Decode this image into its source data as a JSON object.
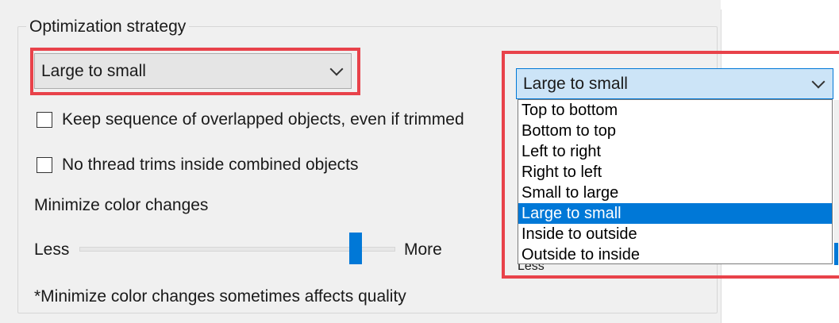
{
  "group": {
    "title": "Optimization strategy"
  },
  "strategy_combo_closed": {
    "value": "Large to small",
    "icon": "chevron-down-icon"
  },
  "strategy_combo_open": {
    "value": "Large to small",
    "icon": "chevron-down-icon",
    "options": [
      "Top to bottom",
      "Bottom to top",
      "Left to right",
      "Right to left",
      "Small to large",
      "Large to small",
      "Inside to outside",
      "Outside to inside"
    ],
    "selected_index": 5
  },
  "checkboxes": [
    {
      "label": "Keep sequence of overlapped objects, even if trimmed",
      "checked": false
    },
    {
      "label": "No thread trims inside combined objects",
      "checked": false
    }
  ],
  "color_changes": {
    "label": "Minimize color changes",
    "less_label": "Less",
    "more_label": "More",
    "level_fraction": 0.88
  },
  "note": "*Minimize color changes sometimes affects quality",
  "peek_text": "Less",
  "colors": {
    "highlight_red": "#e8424a",
    "accent_blue": "#0078d7",
    "selection_bg": "#cce4f7",
    "panel_bg": "#f0f0f0"
  }
}
